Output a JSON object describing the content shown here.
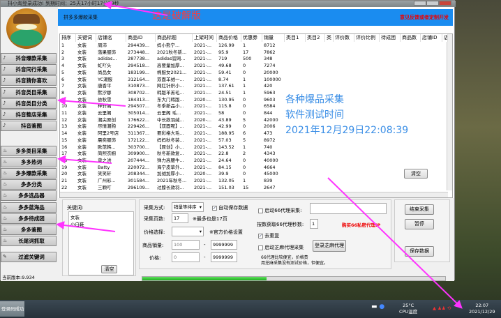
{
  "window": {
    "title": "抖小淘登录成功! 到期时间：25天17小时17分29秒"
  },
  "annotation": {
    "cracked_label": "这是破解版",
    "overlay_lines": [
      "各种爆品采集",
      "软件测试时间",
      "2021年12月29日22:08:39"
    ],
    "accent": "#ff33ff"
  },
  "sidebar": {
    "douyin_items": [
      {
        "label": "抖音爆款采集"
      },
      {
        "label": "抖音同行采集"
      },
      {
        "label": "抖音猜你喜欢"
      },
      {
        "label": "抖音类目采集"
      },
      {
        "label": "抖音类目分类"
      },
      {
        "label": "抖音整店采集"
      },
      {
        "label": "抖音鉴图"
      }
    ],
    "pdd_items": [
      {
        "label": "多多类目采集"
      },
      {
        "label": "多多热词"
      },
      {
        "label": "多多爆款采集"
      },
      {
        "label": "多多分类"
      },
      {
        "label": "多多选品器"
      },
      {
        "label": "多多蓝海品"
      },
      {
        "label": "多多待成团"
      },
      {
        "label": "多多鉴图"
      },
      {
        "label": "长尾词抓取"
      }
    ],
    "filter_label": "过滤关键词",
    "version": "当前版本:9.934"
  },
  "header": {
    "title": "拼多多爆款采集",
    "feedback": "意见反馈或者定制开发",
    "brand_color": "#1a8cf0"
  },
  "table": {
    "columns": [
      "排序",
      "关键词",
      "店铺名",
      "商品ID",
      "商品标题",
      "上架时间",
      "商品价格",
      "优惠券",
      "销量",
      "类目1",
      "类目2",
      "类",
      "评价数",
      "评价比例",
      "待成团",
      "商品数",
      "店铺ID",
      "店"
    ],
    "rows": [
      [
        "1",
        "女装",
        "周沛",
        "294439...",
        "妈小熊宁...",
        "2021-...",
        "126.99",
        "1",
        "8712"
      ],
      [
        "2",
        "女装",
        "落果服饰",
        "273448...",
        "2021秋冬新...",
        "2021-...",
        "95.9",
        "17",
        "7862"
      ],
      [
        "3",
        "女装",
        "adidas...",
        "287738...",
        "adidas官网...",
        "2021-...",
        "719",
        "500",
        "348"
      ],
      [
        "4",
        "女装",
        "虹吖头",
        "294518...",
        "高要量加厚...",
        "2021-...",
        "49.68",
        "0",
        "7274"
      ],
      [
        "5",
        "女装",
        "尚品女",
        "183199...",
        "棉服女2021...",
        "2021-...",
        "59.41",
        "0",
        "20000"
      ],
      [
        "6",
        "女装",
        "YC潮服",
        "312164...",
        "双面羊绒一...",
        "2021-...",
        "8.74",
        "1",
        "100000"
      ],
      [
        "7",
        "女装",
        "唐香平",
        "310873...",
        "网红针织小...",
        "2021-...",
        "137.61",
        "1",
        "420"
      ],
      [
        "8",
        "女装",
        "默汐娜",
        "308702...",
        "韩版羊羔毛...",
        "2021-...",
        "24.51",
        "1",
        "5963"
      ],
      [
        "9",
        "女装",
        "依秋雪",
        "184313...",
        "东大门韩版...",
        "2020-...",
        "130.95",
        "0",
        "9603"
      ],
      [
        "10",
        "女装",
        "梓轩阁",
        "294507...",
        "冬季新品小...",
        "2021-...",
        "115.8",
        "0",
        "6584"
      ],
      [
        "11",
        "女装",
        "云里阁",
        "305014...",
        "云里阁 毛...",
        "2021-...",
        "58",
        "0",
        "844"
      ],
      [
        "12",
        "女装",
        "潮尖原创",
        "176622...",
        "中长款羽绒...",
        "2020-...",
        "43.89",
        "5",
        "42000"
      ],
      [
        "13",
        "女装",
        "尽情潮购",
        "229426...",
        "【双面呢】...",
        "2021-...",
        "42.99",
        "0",
        "2006"
      ],
      [
        "14",
        "女装",
        "阿里2号店",
        "311367...",
        "要彩格大毛...",
        "2021-...",
        "188.95",
        "6",
        "473"
      ],
      [
        "15",
        "女装",
        "晨奕服饰",
        "172122...",
        "妈妈秋冬装...",
        "2021-...",
        "57.03",
        "5",
        "8972"
      ],
      [
        "16",
        "女装",
        "欧范韩...",
        "303700...",
        "【原创】小...",
        "2021-...",
        "143.52",
        "1",
        "740"
      ],
      [
        "17",
        "女装",
        "简熙衣橱",
        "309900...",
        "秋冬新款复...",
        "2021-...",
        "22.8",
        "2",
        "4343"
      ],
      [
        "18",
        "女装",
        "曾之洪",
        "207444...",
        "弹力高腰牛...",
        "2021-...",
        "24.64",
        "0",
        "40000"
      ],
      [
        "19",
        "女装",
        "Batty",
        "220072...",
        "海宁皮草外...",
        "2021-...",
        "84.15",
        "0",
        "4664"
      ],
      [
        "20",
        "女装",
        "笑笑轩",
        "208344...",
        "加绒加厚小...",
        "2020-...",
        "39.9",
        "0",
        "45000"
      ],
      [
        "21",
        "女装",
        "广州彩...",
        "301584...",
        "2021年秋冬...",
        "2021-...",
        "132.05",
        "1",
        "839"
      ],
      [
        "22",
        "女装",
        "三颗叮",
        "296109...",
        "过膝长款羽...",
        "2021-...",
        "151.03",
        "15",
        "2647"
      ]
    ],
    "clear_label": "清空"
  },
  "keywords": {
    "label": "关键词:",
    "value": "女装\n小白鞋",
    "clear_label": "清空"
  },
  "settings": {
    "mode_label": "采集方式:",
    "mode_value": "销量等排序",
    "autosave_label": "自动保存数据",
    "autosave_checked": true,
    "pages_label": "采集页数:",
    "pages_value": "17",
    "pages_note": "※最多也是17页",
    "price_sel_label": "价格选择:",
    "price_sel_value": "",
    "price_note": "※官方价格设置",
    "sales_label": "商品销量:",
    "sales_min": "100",
    "sales_max": "9999999",
    "price_label": "价格:",
    "price_min": "0",
    "price_max": "9999999",
    "proxy66_label": "启动66代理采集:",
    "proxy66_value": "",
    "proxy_secs_label": "按数获取66代理秒数:",
    "proxy_secs_value": "1",
    "buy_proxy": "购买66私密代理IP",
    "dedupe_label": "去重复",
    "dedupe_checked": true,
    "zhima_label": "启动芝麻代理采集",
    "zhima_login": "登录芝麻代理",
    "note1": "66代理比较便宜，价格贵",
    "note2": "用芝麻采集没有测试价格，但便宜。",
    "progress": 0.41
  },
  "actions": {
    "stop": "结束采集",
    "pause": "暂停",
    "save": "保存数据"
  },
  "taskbar": {
    "task": "登录码成功! ...",
    "temp": "25°C",
    "temp_label": "CPU温度",
    "time": "22:07",
    "date": "2021/12/29"
  }
}
